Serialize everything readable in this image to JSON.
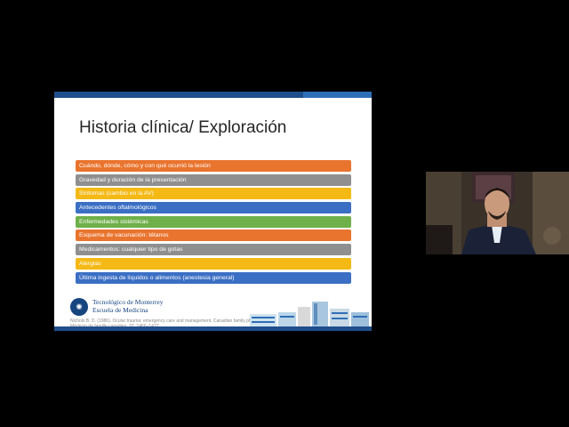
{
  "slide": {
    "title": "Historia clínica/ Exploración",
    "items": [
      {
        "label": "Cuándo, dónde, cómo y con qué ocurrió la lesión",
        "color": "#e9742e"
      },
      {
        "label": "Gravedad y duración de la presentación",
        "color": "#8f8f8f"
      },
      {
        "label": "Síntomas (cambio en la AV)",
        "color": "#f4b915"
      },
      {
        "label": "Antecedentes oftalmológicos",
        "color": "#3b6fc4"
      },
      {
        "label": "Enfermedades sistémicas",
        "color": "#6fb04a"
      },
      {
        "label": "Esquema de vacunación: tétanos",
        "color": "#e9742e"
      },
      {
        "label": "Medicamentos: cualquier tipo de gotas",
        "color": "#8f8f8f"
      },
      {
        "label": "Alergias",
        "color": "#f4b915"
      },
      {
        "label": "Última ingesta de líquidos o alimentos (anestesia general)",
        "color": "#3b6fc4"
      }
    ],
    "logo": {
      "line1": "Tecnológico de Monterrey",
      "line2": "Escuela de Medicina"
    },
    "citation": "Nichols B. D. (1986). Ocular trauma: emergency care and management. Canadian family physician Médecin de famille canadien, 32, 1466–1472."
  }
}
